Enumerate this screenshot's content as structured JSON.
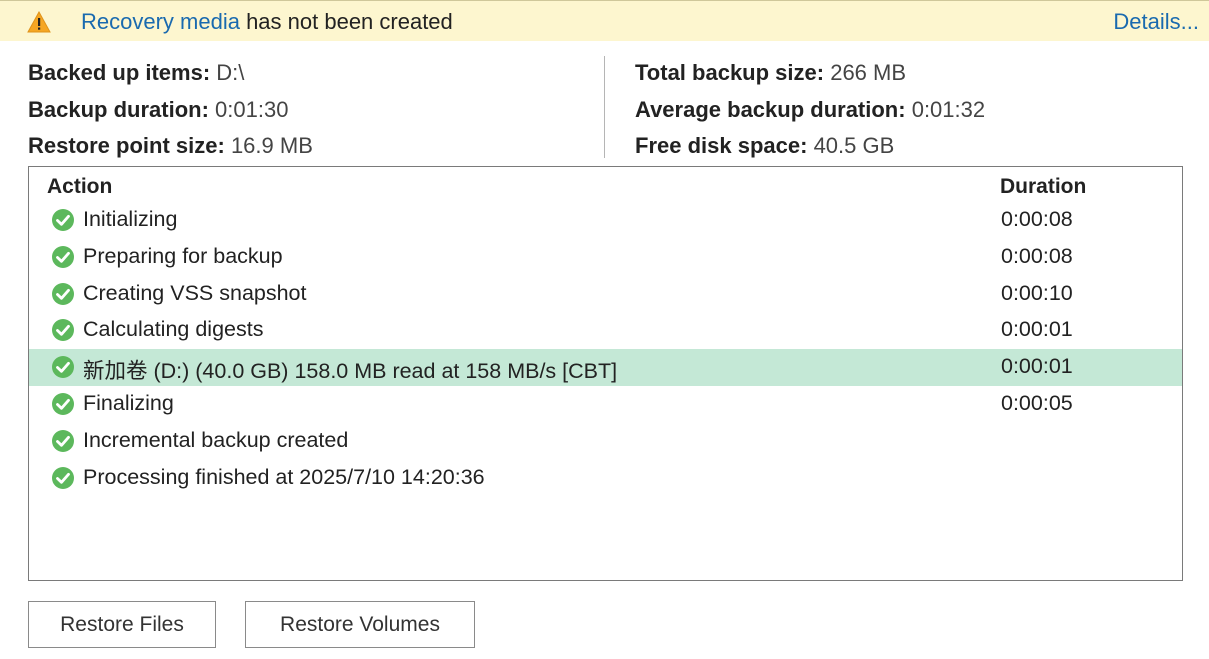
{
  "warning": {
    "link_text": "Recovery media",
    "message": " has not been created",
    "details_label": "Details...",
    "color": "#fdf6cf"
  },
  "stats": {
    "left": [
      {
        "label": "Backed up items:",
        "value": "D:\\"
      },
      {
        "label": "Backup duration:",
        "value": "0:01:30"
      },
      {
        "label": "Restore point size:",
        "value": "16.9 MB"
      }
    ],
    "right": [
      {
        "label": "Total backup size:",
        "value": "266 MB"
      },
      {
        "label": "Average backup duration:",
        "value": "0:01:32"
      },
      {
        "label": "Free disk space:",
        "value": "40.5 GB"
      }
    ]
  },
  "log": {
    "columns": {
      "action": "Action",
      "duration": "Duration"
    },
    "rows": [
      {
        "status_icon": "success-check-icon",
        "action": "Initializing",
        "duration": "0:00:08",
        "selected": false
      },
      {
        "status_icon": "success-check-icon",
        "action": "Preparing for backup",
        "duration": "0:00:08",
        "selected": false
      },
      {
        "status_icon": "success-check-icon",
        "action": "Creating VSS snapshot",
        "duration": "0:00:10",
        "selected": false
      },
      {
        "status_icon": "success-check-icon",
        "action": "Calculating digests",
        "duration": "0:00:01",
        "selected": false
      },
      {
        "status_icon": "success-check-icon",
        "action": "新加卷 (D:) (40.0 GB) 158.0 MB read at 158 MB/s [CBT]",
        "duration": "0:00:01",
        "selected": true
      },
      {
        "status_icon": "success-check-icon",
        "action": "Finalizing",
        "duration": "0:00:05",
        "selected": false
      },
      {
        "status_icon": "success-check-icon",
        "action": "Incremental backup created",
        "duration": "",
        "selected": false
      },
      {
        "status_icon": "success-check-icon",
        "action": "Processing finished at 2025/7/10 14:20:36",
        "duration": "",
        "selected": false
      }
    ],
    "selected_color": "#c4e8d6",
    "success_color": "#5cb85c"
  },
  "buttons": {
    "restore_files": "Restore Files",
    "restore_volumes": "Restore Volumes"
  }
}
